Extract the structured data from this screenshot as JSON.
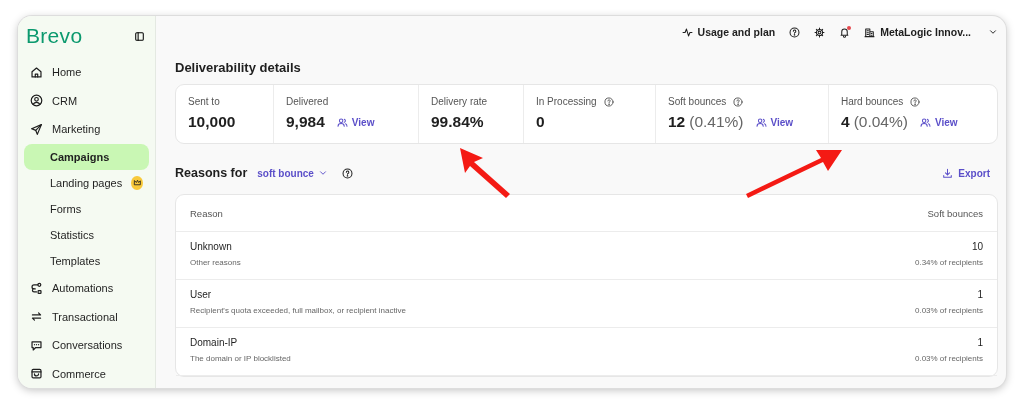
{
  "sidebar": {
    "logo": "Brevo",
    "items": [
      {
        "label": "Home",
        "selected": false
      },
      {
        "label": "CRM",
        "selected": false
      },
      {
        "label": "Marketing",
        "selected": false,
        "children": [
          {
            "label": "Campaigns",
            "selected": true,
            "premium": false
          },
          {
            "label": "Landing pages",
            "selected": false,
            "premium": true
          },
          {
            "label": "Forms",
            "selected": false,
            "premium": false
          },
          {
            "label": "Statistics",
            "selected": false,
            "premium": false
          },
          {
            "label": "Templates",
            "selected": false,
            "premium": false
          }
        ]
      },
      {
        "label": "Automations",
        "selected": false
      },
      {
        "label": "Transactional",
        "selected": false
      },
      {
        "label": "Conversations",
        "selected": false
      },
      {
        "label": "Commerce",
        "selected": false
      }
    ]
  },
  "header": {
    "usage": "Usage and plan",
    "notification": true,
    "account": "MetaLogic Innov..."
  },
  "deliverability": {
    "title": "Deliverability details",
    "stats": [
      {
        "label": "Sent to",
        "help": false,
        "value": "10,000"
      },
      {
        "label": "Delivered",
        "help": false,
        "value": "9,984",
        "link": "View"
      },
      {
        "label": "Delivery rate",
        "help": false,
        "value": "99.84%"
      },
      {
        "label": "In Processing",
        "help": true,
        "value": "0"
      },
      {
        "label": "Soft bounces",
        "help": true,
        "value": "12",
        "percent": "(0.41%)",
        "link": "View"
      },
      {
        "label": "Hard bounces",
        "help": true,
        "value": "4",
        "percent": "(0.04%)",
        "link": "View"
      }
    ]
  },
  "reasons": {
    "title": "Reasons for",
    "filter": "soft bounce",
    "export": "Export",
    "table": {
      "columns": [
        "Reason",
        "Soft bounces"
      ],
      "rows": [
        {
          "reason": "Unknown",
          "description": "Other reasons",
          "count": "10",
          "share": "0.34% of recipients"
        },
        {
          "reason": "User",
          "description": "Recipient's quota exceeded, full mailbox, or recipient inactive",
          "count": "1",
          "share": "0.03% of recipients"
        },
        {
          "reason": "Domain-IP",
          "description": "The domain or IP blocklisted",
          "count": "1",
          "share": "0.03% of recipients"
        }
      ]
    }
  }
}
